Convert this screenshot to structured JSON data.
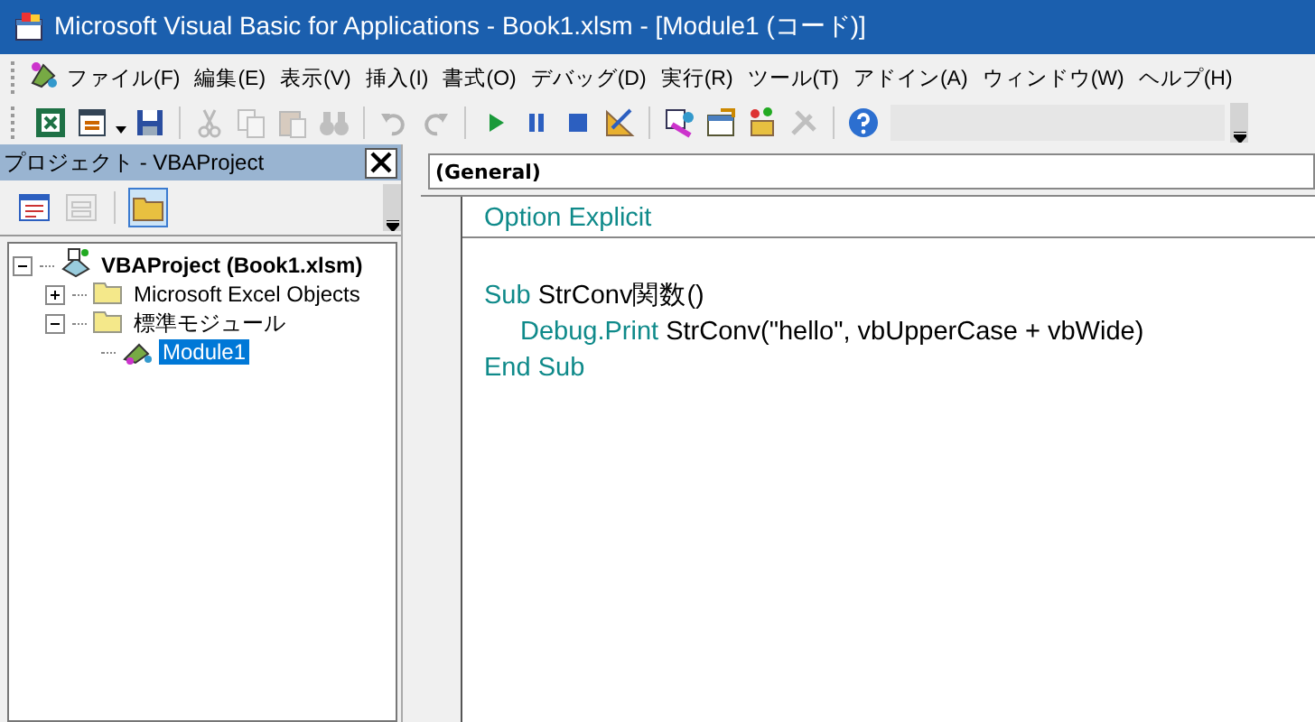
{
  "window": {
    "title": "Microsoft Visual Basic for Applications - Book1.xlsm - [Module1 (コード)]"
  },
  "menu": [
    "ファイル(F)",
    "編集(E)",
    "表示(V)",
    "挿入(I)",
    "書式(O)",
    "デバッグ(D)",
    "実行(R)",
    "ツール(T)",
    "アドイン(A)",
    "ウィンドウ(W)",
    "ヘルプ(H)"
  ],
  "toolbar": [
    {
      "kind": "excel",
      "disabled": false
    },
    {
      "kind": "form",
      "disabled": false
    },
    {
      "kind": "save",
      "disabled": false
    },
    {
      "kind": "separator"
    },
    {
      "kind": "cut",
      "disabled": true
    },
    {
      "kind": "copy",
      "disabled": true
    },
    {
      "kind": "paste",
      "disabled": true
    },
    {
      "kind": "find",
      "disabled": true
    },
    {
      "kind": "separator"
    },
    {
      "kind": "undo",
      "disabled": true
    },
    {
      "kind": "redo",
      "disabled": true
    },
    {
      "kind": "separator"
    },
    {
      "kind": "run",
      "disabled": false
    },
    {
      "kind": "pause",
      "disabled": false
    },
    {
      "kind": "stop",
      "disabled": false
    },
    {
      "kind": "design",
      "disabled": false
    },
    {
      "kind": "separator"
    },
    {
      "kind": "explorer",
      "disabled": false
    },
    {
      "kind": "properties",
      "disabled": false
    },
    {
      "kind": "browser",
      "disabled": false
    },
    {
      "kind": "toolbox",
      "disabled": true
    },
    {
      "kind": "separator"
    },
    {
      "kind": "help",
      "disabled": false
    }
  ],
  "project_pane": {
    "title": "プロジェクト - VBAProject",
    "buttons": [
      {
        "kind": "code",
        "disabled": false,
        "selected": false
      },
      {
        "kind": "object",
        "disabled": true,
        "selected": false
      },
      {
        "kind": "folders",
        "disabled": false,
        "selected": true
      }
    ],
    "tree": [
      {
        "label": "VBAProject (Book1.xlsm)",
        "kind": "project",
        "expanded": true,
        "selected": false,
        "children": [
          {
            "label": "Microsoft Excel Objects",
            "kind": "folder",
            "expanded": false,
            "selected": false
          },
          {
            "label": "標準モジュール",
            "kind": "folder",
            "expanded": true,
            "selected": false,
            "children": [
              {
                "label": "Module1",
                "kind": "module",
                "selected": true
              }
            ]
          }
        ]
      }
    ]
  },
  "code_window": {
    "object": "(General)",
    "sections": [
      {
        "lines": [
          {
            "kind": "code",
            "indented": false,
            "tokens": [
              {
                "text": "Option Explicit",
                "kind": "keyword"
              }
            ]
          }
        ]
      },
      {
        "lines": [
          {
            "kind": "blank"
          },
          {
            "kind": "code",
            "indented": false,
            "tokens": [
              {
                "text": "Sub",
                "kind": "keyword"
              },
              {
                "text": " StrConv関数()",
                "kind": "plain"
              }
            ]
          },
          {
            "kind": "code",
            "indented": true,
            "tokens": [
              {
                "text": "Debug.Print",
                "kind": "keyword"
              },
              {
                "text": " StrConv(\"hello\", vbUpperCase + vbWide)",
                "kind": "plain"
              }
            ]
          },
          {
            "kind": "code",
            "indented": false,
            "tokens": [
              {
                "text": "End Sub",
                "kind": "keyword"
              }
            ]
          }
        ]
      }
    ]
  }
}
